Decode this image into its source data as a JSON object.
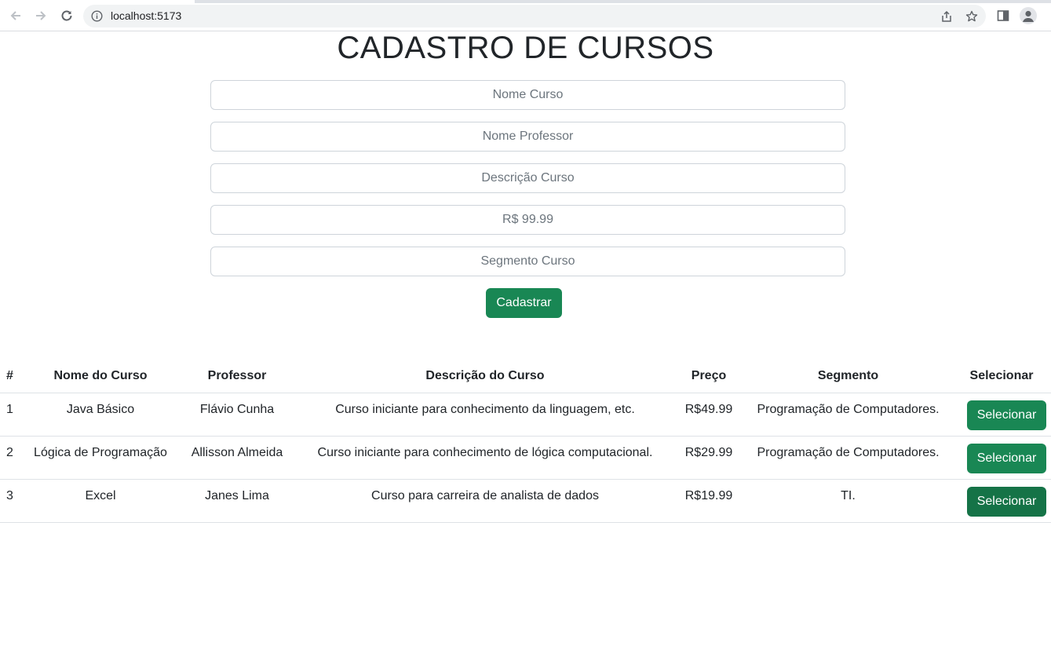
{
  "browser": {
    "url": "localhost:5173"
  },
  "page": {
    "title": "CADASTRO DE CURSOS"
  },
  "form": {
    "nome_curso_placeholder": "Nome Curso",
    "nome_professor_placeholder": "Nome Professor",
    "descricao_placeholder": "Descrição Curso",
    "preco_placeholder": "R$ 99.99",
    "segmento_placeholder": "Segmento Curso",
    "submit_label": "Cadastrar"
  },
  "table": {
    "headers": [
      "#",
      "Nome do Curso",
      "Professor",
      "Descrição do Curso",
      "Preço",
      "Segmento",
      "Selecionar"
    ],
    "rows": [
      {
        "id": "1",
        "nome": "Java Básico",
        "professor": "Flávio Cunha",
        "descricao": "Curso iniciante para conhecimento da linguagem, etc.",
        "preco": "R$49.99",
        "segmento": "Programação de Computadores.",
        "action": "Selecionar"
      },
      {
        "id": "2",
        "nome": "Lógica de Programação",
        "professor": "Allisson Almeida",
        "descricao": "Curso iniciante para conhecimento de lógica computacional.",
        "preco": "R$29.99",
        "segmento": "Programação de Computadores.",
        "action": "Selecionar"
      },
      {
        "id": "3",
        "nome": "Excel",
        "professor": "Janes Lima",
        "descricao": "Curso para carreira de analista de dados",
        "preco": "R$19.99",
        "segmento": "TI.",
        "action": "Selecionar"
      }
    ]
  },
  "colors": {
    "accent_green": "#198754",
    "accent_green_hover": "#157347"
  }
}
